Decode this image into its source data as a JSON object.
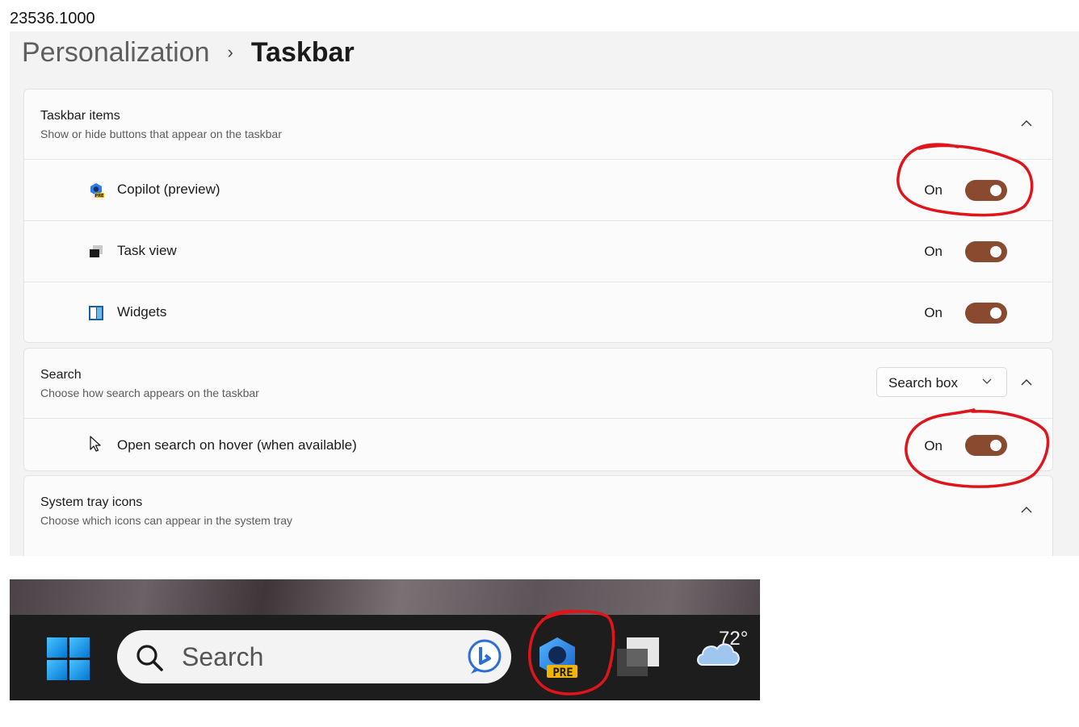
{
  "build_number": "23536.1000",
  "breadcrumb": {
    "parent": "Personalization",
    "separator": "›",
    "current": "Taskbar"
  },
  "taskbar_items": {
    "title": "Taskbar items",
    "subtitle": "Show or hide buttons that appear on the taskbar",
    "items": [
      {
        "label": "Copilot (preview)",
        "state": "On",
        "icon": "copilot-icon"
      },
      {
        "label": "Task view",
        "state": "On",
        "icon": "task-view-icon"
      },
      {
        "label": "Widgets",
        "state": "On",
        "icon": "widgets-icon"
      }
    ]
  },
  "search_section": {
    "title": "Search",
    "subtitle": "Choose how search appears on the taskbar",
    "dropdown_value": "Search box",
    "hover_label": "Open search on hover (when available)",
    "hover_state": "On"
  },
  "system_tray": {
    "title": "System tray icons",
    "subtitle": "Choose which icons can appear in the system tray"
  },
  "taskbar": {
    "search_placeholder": "Search",
    "copilot_badge": "PRE",
    "temperature": "72°"
  },
  "colors": {
    "toggle_on": "#8a4a30",
    "annotation": "#e0151b",
    "settings_bg": "#f3f3f3",
    "taskbar_bg": "#1d1d1d"
  }
}
